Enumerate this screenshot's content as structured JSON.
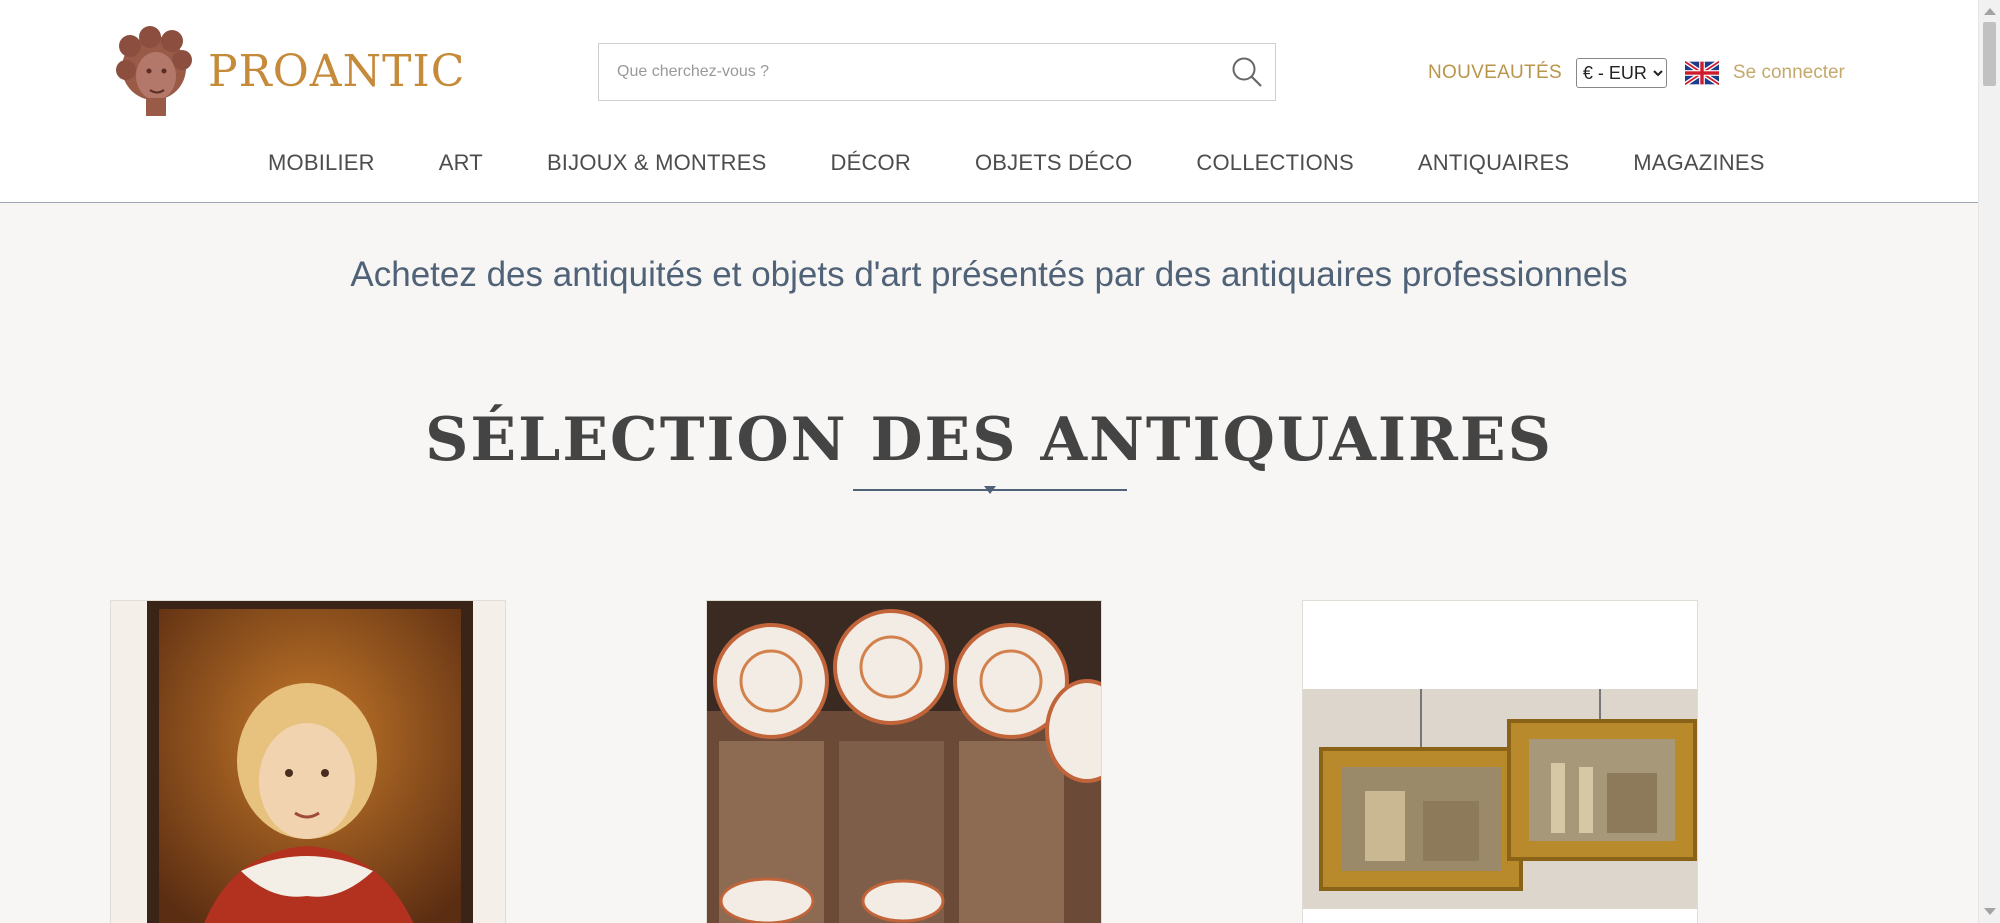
{
  "header": {
    "logo_text": "PROANTIC",
    "search": {
      "placeholder": "Que cherchez-vous ?"
    },
    "new_label": "NOUVEAUTÉS",
    "currency": {
      "selected": "€ - EUR"
    },
    "login_label": "Se connecter"
  },
  "nav": {
    "items": [
      {
        "label": "MOBILIER"
      },
      {
        "label": "ART"
      },
      {
        "label": "BIJOUX & MONTRES"
      },
      {
        "label": "DÉCOR"
      },
      {
        "label": "OBJETS DÉCO"
      },
      {
        "label": "COLLECTIONS"
      },
      {
        "label": "ANTIQUAIRES"
      },
      {
        "label": "MAGAZINES"
      }
    ]
  },
  "main": {
    "tagline": "Achetez des antiquités et objets d'art présentés par des antiquaires professionnels",
    "section_title": "SÉLECTION DES ANTIQUAIRES"
  },
  "colors": {
    "brand": "#c58a3a",
    "accent": "#4f6278",
    "new_link": "#b8954a",
    "login": "#c5a86c"
  },
  "icons": [
    "logo-head-icon",
    "search-icon",
    "uk-flag-icon"
  ]
}
